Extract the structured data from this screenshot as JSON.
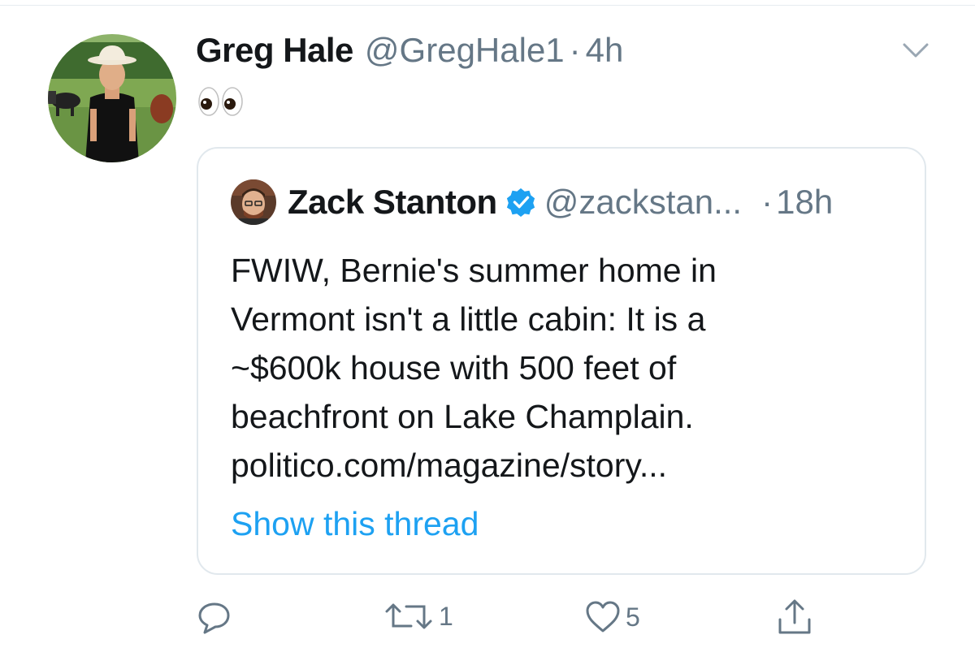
{
  "tweet": {
    "author_name": "Greg Hale",
    "author_handle": "@GregHale1",
    "separator": "·",
    "time": "4h",
    "text_emoji": "👀"
  },
  "quoted": {
    "author_name": "Zack Stanton",
    "author_handle": "@zackstan...",
    "separator": "·",
    "time": "18h",
    "verified": true,
    "lines": [
      "FWIW, Bernie's summer home in",
      "Vermont isn't a little cabin: It is a",
      "~$600k house with 500 feet of",
      "beachfront on Lake Champlain.",
      "politico.com/magazine/story..."
    ],
    "show_thread": "Show this thread"
  },
  "actions": {
    "reply_count": "",
    "retweet_count": "1",
    "like_count": "5"
  },
  "icons": {
    "caret": "chevron-down-icon",
    "verified": "verified-badge-icon",
    "reply": "reply-icon",
    "retweet": "retweet-icon",
    "like": "heart-icon",
    "share": "share-icon"
  },
  "colors": {
    "link": "#1da1f2",
    "muted": "#657786",
    "text": "#14171a",
    "border": "#e1e8ed"
  }
}
